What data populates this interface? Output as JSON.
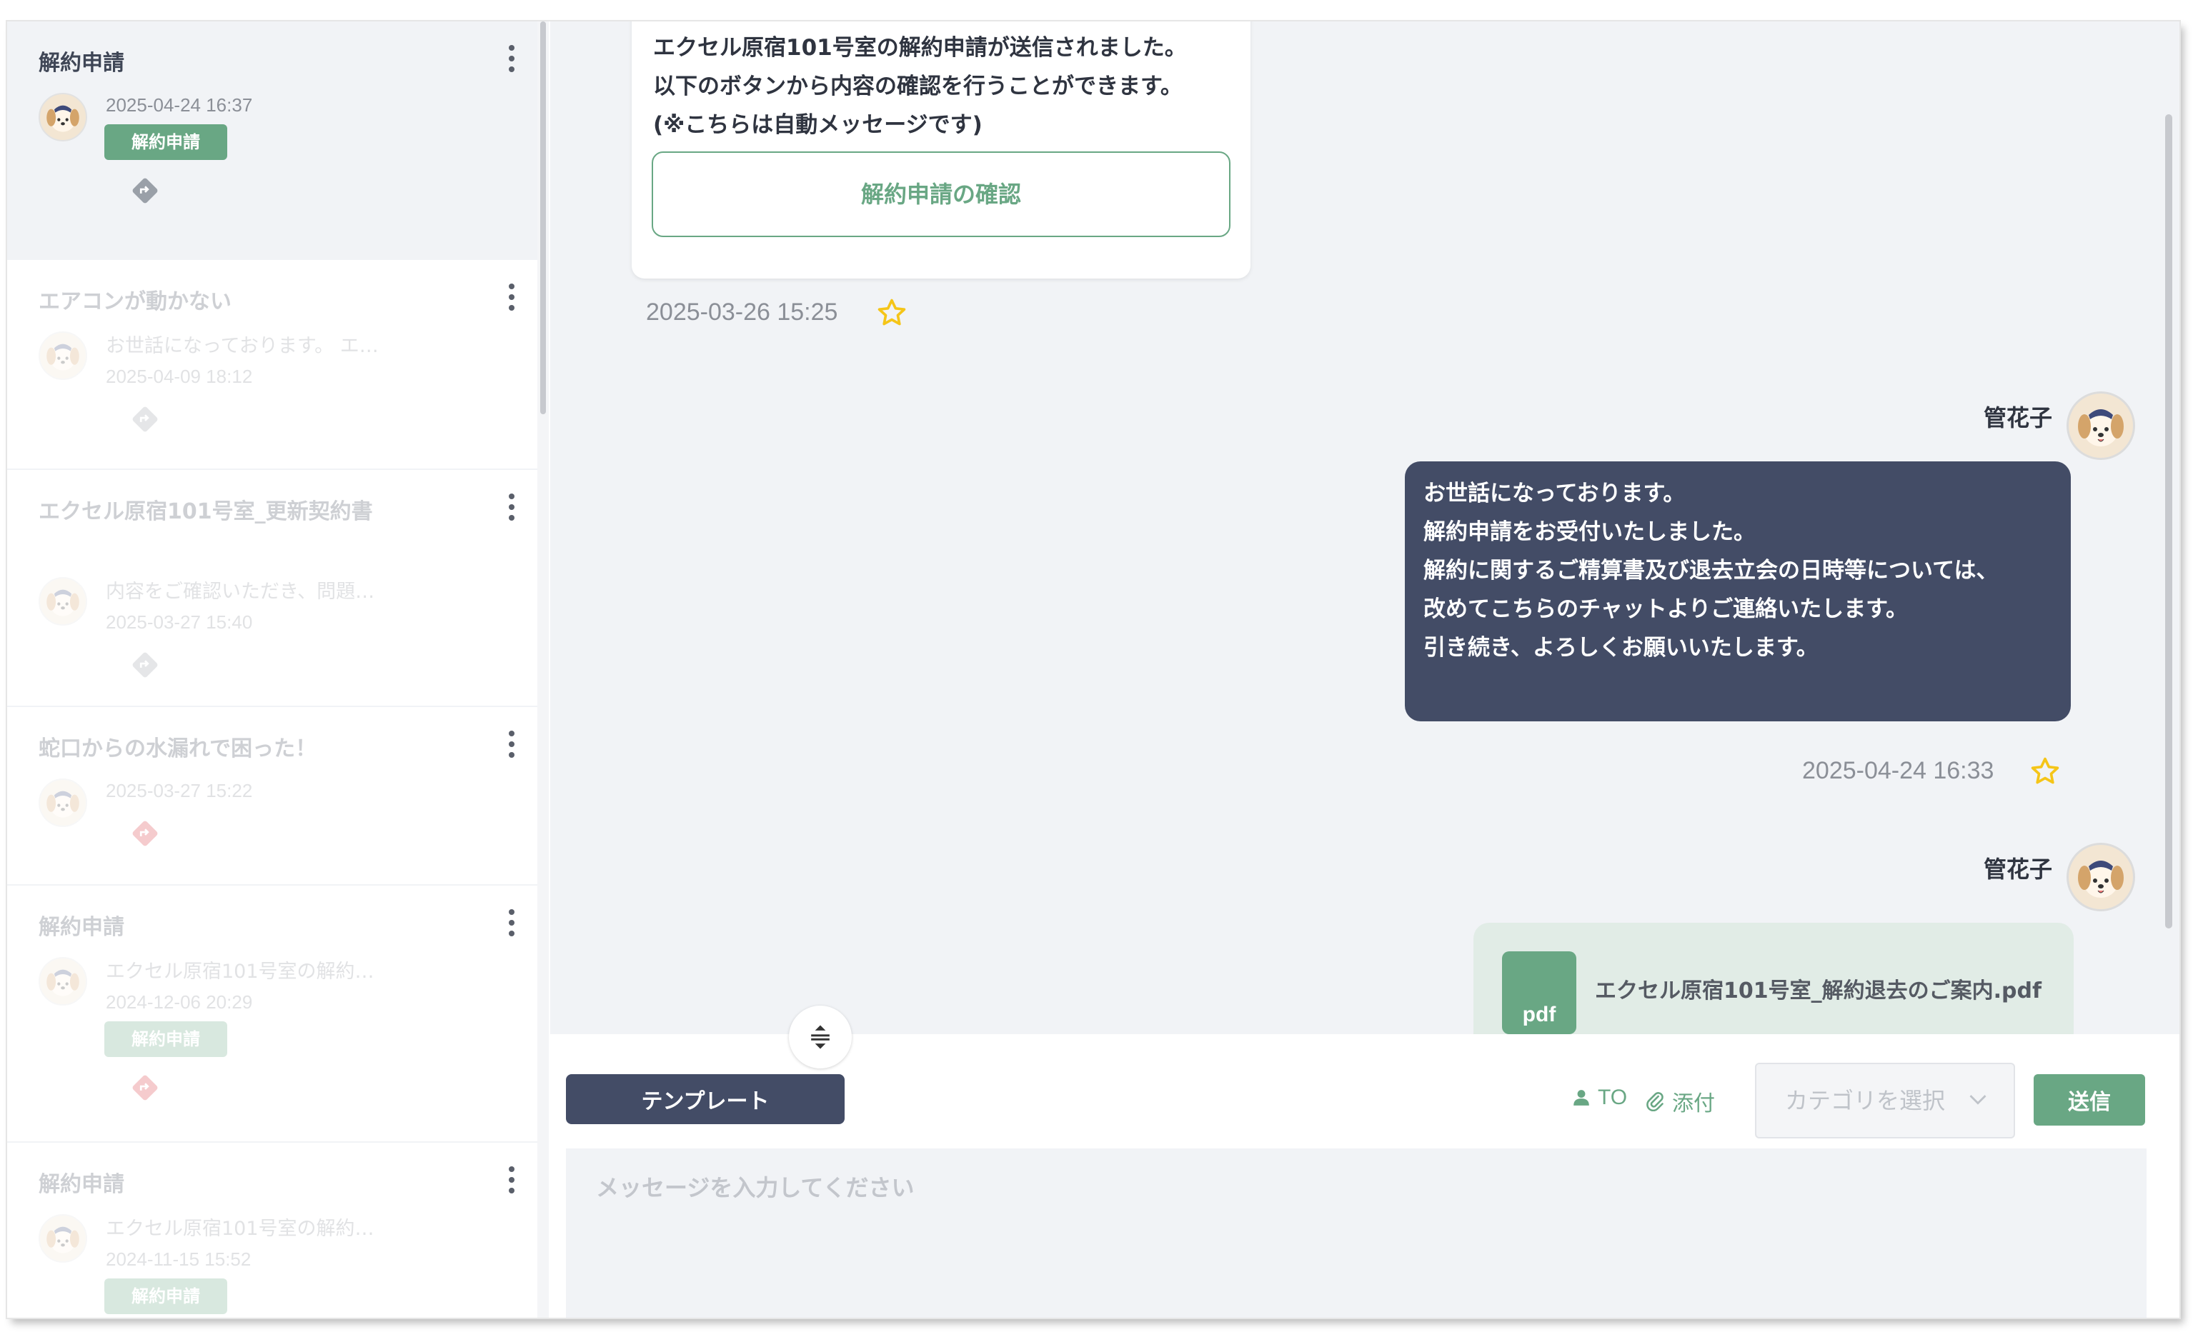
{
  "sidebar": {
    "threads": [
      {
        "title": "解約申請",
        "snippet": "",
        "date": "2025-04-24 16:37",
        "badge": "解約申請",
        "diamond_color": "#9aa0a8"
      },
      {
        "title": "エアコンが動かない",
        "snippet": "お世話になっております。 エ…",
        "date": "2025-04-09 18:12",
        "badge": "",
        "diamond_color": "#9aa0a8"
      },
      {
        "title": "エクセル原宿101号室_更新契約書",
        "snippet": "内容をご確認いただき、問題…",
        "date": "2025-03-27 15:40",
        "badge": "",
        "diamond_color": "#9aa0a8"
      },
      {
        "title": "蛇口からの水漏れで困った！",
        "snippet": "",
        "date": "2025-03-27 15:22",
        "badge": "",
        "diamond_color": "#d9363e"
      },
      {
        "title": "解約申請",
        "snippet": "エクセル原宿101号室の解約…",
        "date": "2024-12-06 20:29",
        "badge": "解約申請",
        "diamond_color": "#d9363e"
      },
      {
        "title": "解約申請",
        "snippet": "エクセル原宿101号室の解約…",
        "date": "2024-11-15 15:52",
        "badge": "解約申請",
        "diamond_color": "#9aa0a8"
      }
    ]
  },
  "chat": {
    "system_message": {
      "lines": "エクセル原宿101号室の解約申請が送信されました。\n以下のボタンから内容の確認を行うことができます。\n(※こちらは自動メッセージです)",
      "button_label": "解約申請の確認",
      "timestamp": "2025-03-26 15:25"
    },
    "message_1": {
      "sender": "管花子",
      "lines": "お世話になっております。\n解約申請をお受付いたしました。\n解約に関するご精算書及び退去立会の日時等については、\n改めてこちらのチャットよりご連絡いたします。\n引き続き、よろしくお願いいたします。",
      "timestamp": "2025-04-24 16:33"
    },
    "message_2": {
      "sender": "管花子",
      "attachment_type": "pdf",
      "attachment_name": "エクセル原宿101号室_解約退去のご案内.pdf"
    }
  },
  "composer": {
    "template_label": "テンプレート",
    "to_label": "TO",
    "attach_label": "添付",
    "category_placeholder": "カテゴリを選択",
    "send_label": "送信",
    "message_placeholder": "メッセージを入力してください"
  },
  "colors": {
    "accent_green": "#69a784",
    "dark_navy": "#434c66",
    "star_yellow": "#f5c518",
    "background_gray": "#f1f3f6"
  }
}
